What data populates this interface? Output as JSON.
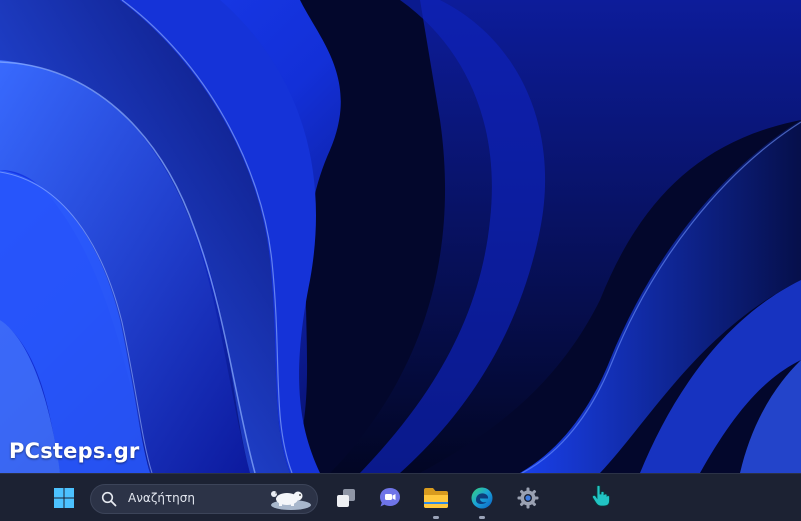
{
  "desktop": {
    "wallpaper": "windows-11-bloom-blue",
    "watermark": "PCsteps.gr"
  },
  "taskbar": {
    "start_icon": "windows-logo-icon",
    "search": {
      "placeholder": "Αναζήτηση",
      "icon": "search-icon",
      "highlight": "polar-bear-illustration"
    },
    "apps": [
      {
        "name": "Task View",
        "icon": "task-view-icon",
        "running": false
      },
      {
        "name": "Chat",
        "icon": "teams-chat-icon",
        "running": false
      },
      {
        "name": "File Explorer",
        "icon": "folder-icon",
        "running": true
      },
      {
        "name": "Microsoft Edge",
        "icon": "edge-icon",
        "running": true
      },
      {
        "name": "Settings",
        "icon": "gear-icon",
        "running": false
      }
    ],
    "background": "#1c2233"
  },
  "cursor": {
    "type": "hand-pointer",
    "color": "#21c4c4"
  }
}
